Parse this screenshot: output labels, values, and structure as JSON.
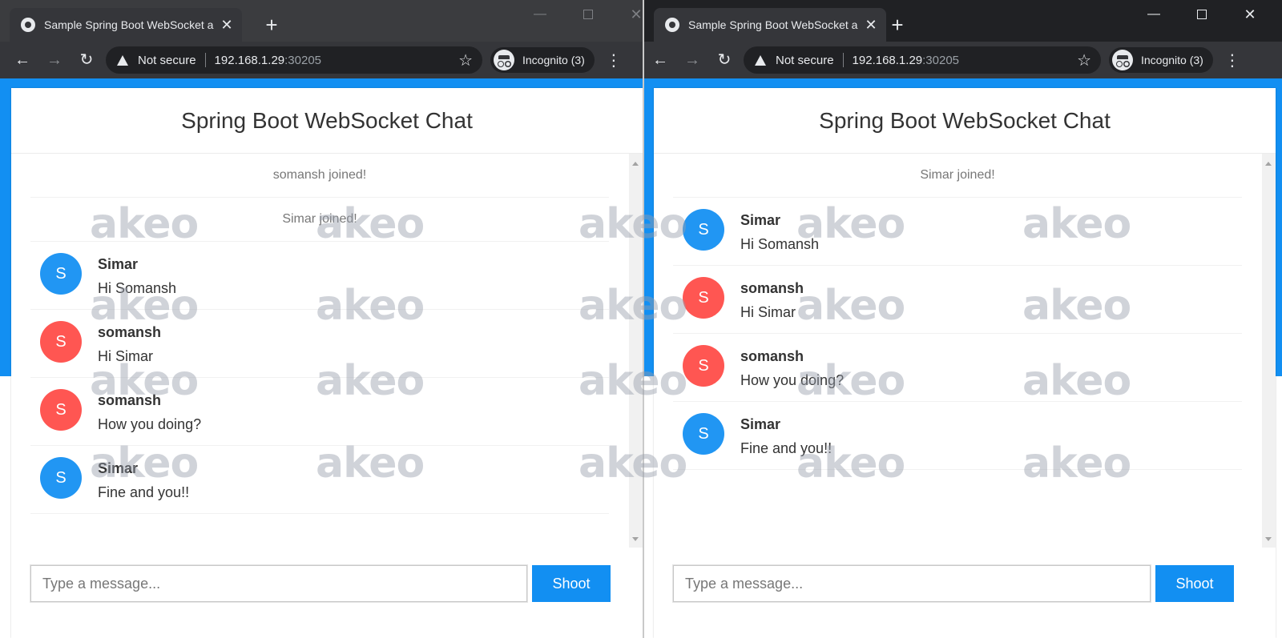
{
  "windows": {
    "left": {
      "tab_title": "Sample Spring Boot WebSocket a",
      "tab_close": "✕",
      "new_tab": "+",
      "security_label": "Not secure",
      "url_host": "192.168.1.29",
      "url_port": ":30205",
      "incognito_label": "Incognito (3)",
      "chat_title": "Spring Boot WebSocket Chat",
      "messages": [
        {
          "type": "event",
          "text": "somansh joined!"
        },
        {
          "type": "event",
          "text": "Simar joined!"
        },
        {
          "type": "chat",
          "initial": "S",
          "sender": "Simar",
          "text": "Hi Somansh",
          "color": "#2196f3"
        },
        {
          "type": "chat",
          "initial": "S",
          "sender": "somansh",
          "text": "Hi Simar",
          "color": "#ff5652"
        },
        {
          "type": "chat",
          "initial": "S",
          "sender": "somansh",
          "text": "How you doing?",
          "color": "#ff5652"
        },
        {
          "type": "chat",
          "initial": "S",
          "sender": "Simar",
          "text": "Fine and you!!",
          "color": "#2196f3"
        }
      ],
      "input_placeholder": "Type a message...",
      "send_label": "Shoot"
    },
    "right": {
      "tab_title": "Sample Spring Boot WebSocket a",
      "tab_close": "✕",
      "new_tab": "+",
      "security_label": "Not secure",
      "url_host": "192.168.1.29",
      "url_port": ":30205",
      "incognito_label": "Incognito (3)",
      "chat_title": "Spring Boot WebSocket Chat",
      "messages": [
        {
          "type": "event",
          "text": "Simar joined!"
        },
        {
          "type": "chat",
          "initial": "S",
          "sender": "Simar",
          "text": "Hi Somansh",
          "color": "#2196f3"
        },
        {
          "type": "chat",
          "initial": "S",
          "sender": "somansh",
          "text": "Hi Simar",
          "color": "#ff5652"
        },
        {
          "type": "chat",
          "initial": "S",
          "sender": "somansh",
          "text": "How you doing?",
          "color": "#ff5652"
        },
        {
          "type": "chat",
          "initial": "S",
          "sender": "Simar",
          "text": "Fine and you!!",
          "color": "#2196f3"
        }
      ],
      "input_placeholder": "Type a message...",
      "send_label": "Shoot"
    }
  },
  "watermark_text": "akeo",
  "colors": {
    "accent": "#128ff2",
    "avatar_blue": "#2196f3",
    "avatar_red": "#ff5652"
  }
}
